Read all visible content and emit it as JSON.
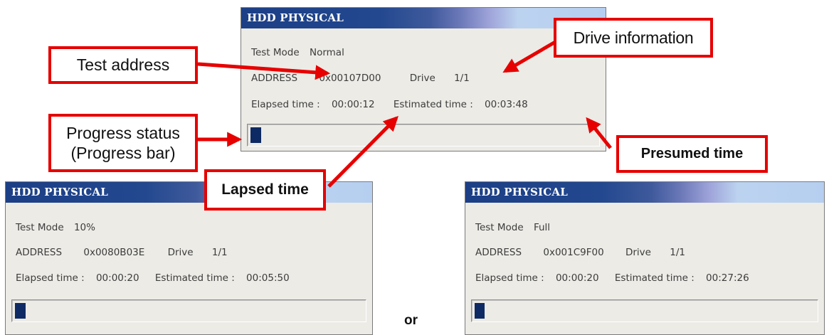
{
  "windows": [
    {
      "title": "HDD PHYSICAL",
      "test_mode_label": "Test Mode",
      "test_mode_value": "Normal",
      "address_label": "ADDRESS",
      "address_value": "0x00107D00",
      "drive_label": "Drive",
      "drive_value": "1/1",
      "elapsed_label": "Elapsed time :",
      "elapsed_value": "00:00:12",
      "estimated_label": "Estimated time :",
      "estimated_value": "00:03:48",
      "progress_fraction": 0.03
    },
    {
      "title": "HDD PHYSICAL",
      "test_mode_label": "Test Mode",
      "test_mode_value": "10%",
      "address_label": "ADDRESS",
      "address_value": "0x0080B03E",
      "drive_label": "Drive",
      "drive_value": "1/1",
      "elapsed_label": "Elapsed time :",
      "elapsed_value": "00:00:20",
      "estimated_label": "Estimated time :",
      "estimated_value": "00:05:50",
      "progress_fraction": 0.03
    },
    {
      "title": "HDD PHYSICAL",
      "test_mode_label": "Test Mode",
      "test_mode_value": "Full",
      "address_label": "ADDRESS",
      "address_value": "0x001C9F00",
      "drive_label": "Drive",
      "drive_value": "1/1",
      "elapsed_label": "Elapsed time :",
      "elapsed_value": "00:00:20",
      "estimated_label": "Estimated time :",
      "estimated_value": "00:27:26",
      "progress_fraction": 0.03
    }
  ],
  "callouts": {
    "test_address": "Test address",
    "drive_information": "Drive information",
    "progress_status_line1": "Progress status",
    "progress_status_line2": "(Progress bar)",
    "lapsed_time": "Lapsed time",
    "presumed_time": "Presumed time"
  },
  "separator": "or",
  "colors": {
    "callout_border": "#e60000",
    "arrow": "#e60000",
    "progress_fill": "#0e2a64",
    "title_text": "#ffffff"
  }
}
